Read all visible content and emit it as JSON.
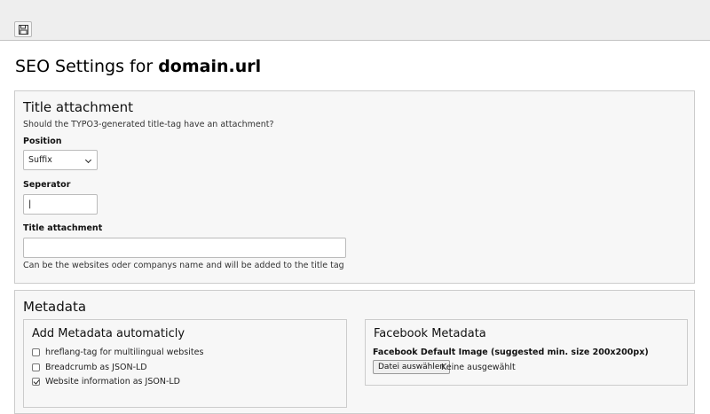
{
  "toolbar": {
    "save_icon": "save-icon"
  },
  "page": {
    "title_prefix": "SEO Settings for ",
    "title_domain": "domain.url"
  },
  "title_attachment": {
    "heading": "Title attachment",
    "description": "Should the TYPO3-generated title-tag have an attachment?",
    "position_label": "Position",
    "position_value": "Suffix",
    "separator_label": "Seperator",
    "separator_value": "|",
    "title_label": "Title attachment",
    "title_value": "",
    "title_help": "Can be the websites oder companys name and will be added to the title tag"
  },
  "metadata": {
    "heading": "Metadata",
    "auto": {
      "heading": "Add Metadata automaticly",
      "items": [
        {
          "label": "hreflang-tag for multilingual websites",
          "checked": false
        },
        {
          "label": "Breadcrumb as JSON-LD",
          "checked": false
        },
        {
          "label": "Website information as JSON-LD",
          "checked": true
        }
      ]
    },
    "facebook": {
      "heading": "Facebook Metadata",
      "image_label": "Facebook Default Image (suggested min. size 200x200px)",
      "file_button": "Datei auswählen",
      "file_status": "Keine ausgewählt"
    }
  }
}
